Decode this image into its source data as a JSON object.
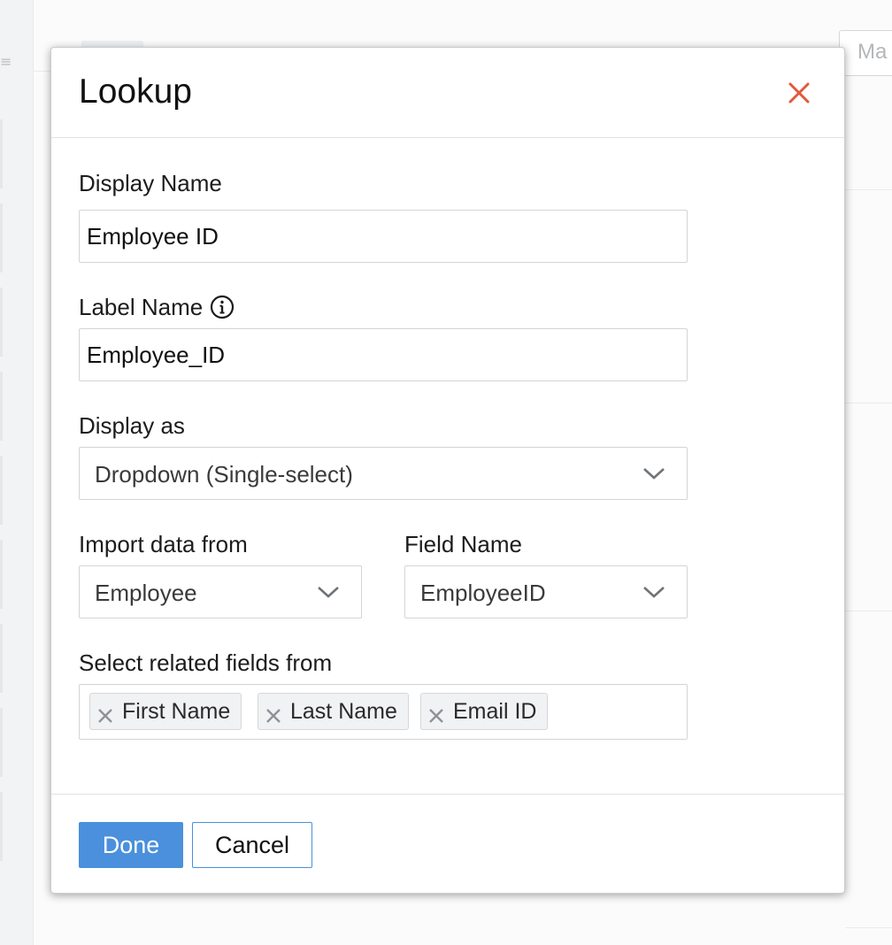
{
  "background": {
    "search_placeholder": "Ma"
  },
  "dialog": {
    "title": "Lookup",
    "close_icon": "close-x-icon",
    "close_color": "#e2583e"
  },
  "fields": {
    "display_name": {
      "label": "Display Name",
      "value": "Employee ID"
    },
    "label_name": {
      "label": "Label Name",
      "value": "Employee_ID",
      "info_icon": "info-circle-icon"
    },
    "display_as": {
      "label": "Display as",
      "selected": "Dropdown (Single-select)"
    },
    "import_data_from": {
      "label": "Import data from",
      "selected": "Employee"
    },
    "field_name": {
      "label": "Field Name",
      "selected": "EmployeeID"
    },
    "related_fields": {
      "label": "Select related fields from",
      "tags": [
        "First Name",
        "Last Name",
        "Email ID"
      ]
    }
  },
  "footer": {
    "done_label": "Done",
    "cancel_label": "Cancel",
    "primary_color": "#4a90dc"
  }
}
